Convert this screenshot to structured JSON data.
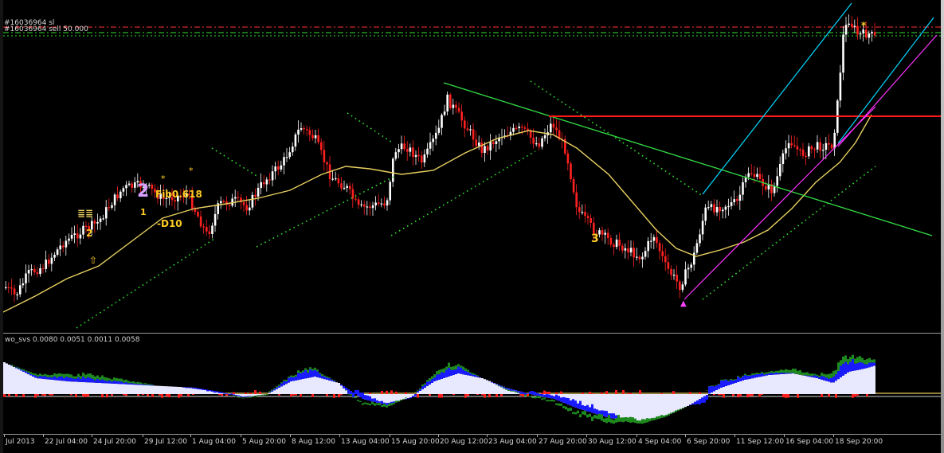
{
  "order_lines": {
    "sl_label": "#16036964 sl",
    "sell_label": "#16036964 sell 50.000"
  },
  "indicator": {
    "label": "wo_svs 0.0080 0.0051 0.0011 0.0058"
  },
  "chart_labels": {
    "fib_text": "Fib0.618",
    "d_text": "-D10"
  },
  "time_axis": [
    "Jul 2013",
    "22 Jul 04:00",
    "24 Jul 20:00",
    "29 Jul 12:00",
    "1 Aug 04:00",
    "5 Aug 20:00",
    "8 Aug 12:00",
    "13 Aug 04:00",
    "15 Aug 20:00",
    "20 Aug 12:00",
    "23 Aug 04:00",
    "27 Aug 20:00",
    "30 Aug 12:00",
    "4 Sep 04:00",
    "6 Sep 20:00",
    "11 Sep 12:00",
    "16 Sep 04:00",
    "18 Sep 20:00"
  ],
  "colors": {
    "background": "#000000",
    "bull_candle": "#ffffff",
    "bear_candle": "#ff2020",
    "moving_average": "#e8d060",
    "trend_green": "#33dd44",
    "dotted_green": "#33dd33",
    "channel_cyan": "#00d8ff",
    "channel_magenta": "#ff33ff",
    "resistance_red": "#ff1a1a",
    "sl_line": "#ff3030",
    "sell_line": "#38e038",
    "hist_white": "#e8e8ff",
    "hist_blue": "#1a1aff",
    "hist_green": "#1e8a1e",
    "hist_red": "#ff2020"
  }
}
